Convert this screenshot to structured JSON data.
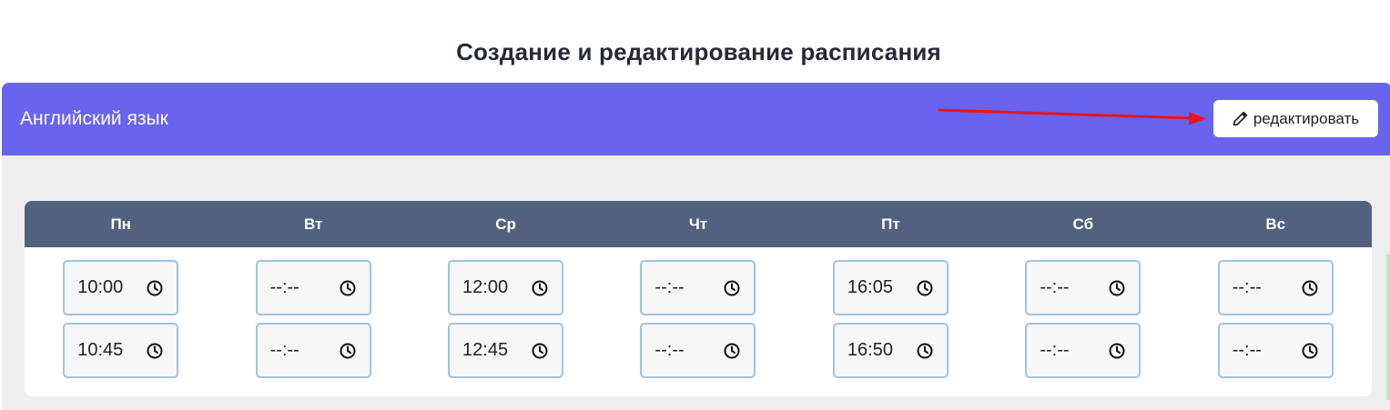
{
  "page": {
    "title": "Создание и редактирование расписания"
  },
  "card": {
    "title": "Английский язык",
    "edit_label": "редактировать"
  },
  "schedule": {
    "days": [
      {
        "label": "Пн",
        "times": [
          "10:00",
          "10:45"
        ]
      },
      {
        "label": "Вт",
        "times": [
          "--:--",
          "--:--"
        ]
      },
      {
        "label": "Ср",
        "times": [
          "12:00",
          "12:45"
        ]
      },
      {
        "label": "Чт",
        "times": [
          "--:--",
          "--:--"
        ]
      },
      {
        "label": "Пт",
        "times": [
          "16:05",
          "16:50"
        ]
      },
      {
        "label": "Сб",
        "times": [
          "--:--",
          "--:--"
        ]
      },
      {
        "label": "Вс",
        "times": [
          "--:--",
          "--:--"
        ]
      }
    ]
  },
  "colors": {
    "header": "#6a63ee",
    "days_header": "#52617e",
    "input_border": "#9cc3e8",
    "annotation_arrow": "#e8141b"
  },
  "icons": {
    "edit": "pencil-icon",
    "time": "clock-icon"
  }
}
